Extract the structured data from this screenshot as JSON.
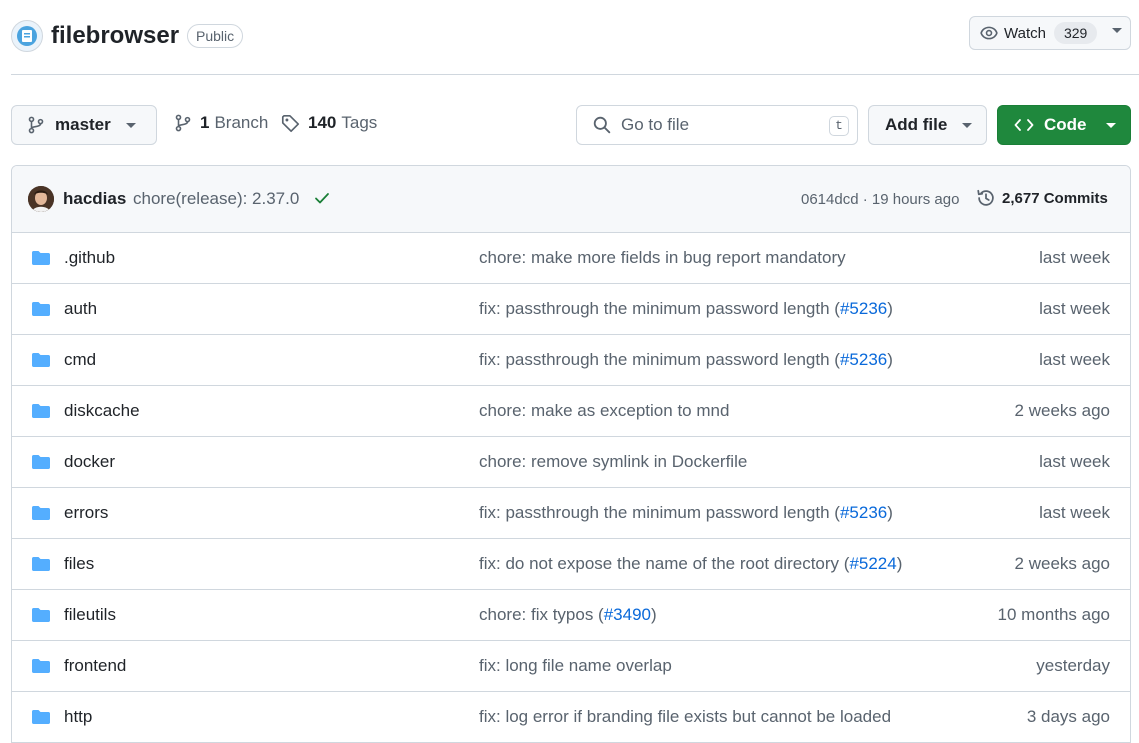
{
  "repo": {
    "name": "filebrowser",
    "visibility": "Public",
    "watch_label": "Watch",
    "watch_count": "329"
  },
  "toolbar": {
    "branch": "master",
    "branch_count": "1",
    "branch_label": "Branch",
    "tags_count": "140",
    "tags_label": "Tags",
    "goto_placeholder": "Go to file",
    "goto_shortcut": "t",
    "add_file_label": "Add file",
    "code_label": "Code"
  },
  "latest_commit": {
    "author": "hacdias",
    "message": "chore(release): 2.37.0",
    "sha_time": "0614dcd · 19 hours ago",
    "commits_label": "2,677 Commits"
  },
  "files": [
    {
      "name": ".github",
      "message": "chore: make more fields in bug report mandatory",
      "pr": "",
      "age": "last week"
    },
    {
      "name": "auth",
      "message": "fix: passthrough the minimum password length (",
      "pr": "#5236",
      "age": "last week"
    },
    {
      "name": "cmd",
      "message": "fix: passthrough the minimum password length (",
      "pr": "#5236",
      "age": "last week"
    },
    {
      "name": "diskcache",
      "message": "chore: make as exception to mnd",
      "pr": "",
      "age": "2 weeks ago"
    },
    {
      "name": "docker",
      "message": "chore: remove symlink in Dockerfile",
      "pr": "",
      "age": "last week"
    },
    {
      "name": "errors",
      "message": "fix: passthrough the minimum password length (",
      "pr": "#5236",
      "age": "last week"
    },
    {
      "name": "files",
      "message": "fix: do not expose the name of the root directory (",
      "pr": "#5224",
      "age": "2 weeks ago"
    },
    {
      "name": "fileutils",
      "message": "chore: fix typos (",
      "pr": "#3490",
      "age": "10 months ago"
    },
    {
      "name": "frontend",
      "message": "fix: long file name overlap",
      "pr": "",
      "age": "yesterday"
    },
    {
      "name": "http",
      "message": "fix: log error if branding file exists but cannot be loaded",
      "pr": "",
      "age": "3 days ago"
    }
  ],
  "colors": {
    "folder": "#54aeff",
    "link": "#0969da",
    "code_button": "#1f883d",
    "check": "#1a7f37"
  }
}
